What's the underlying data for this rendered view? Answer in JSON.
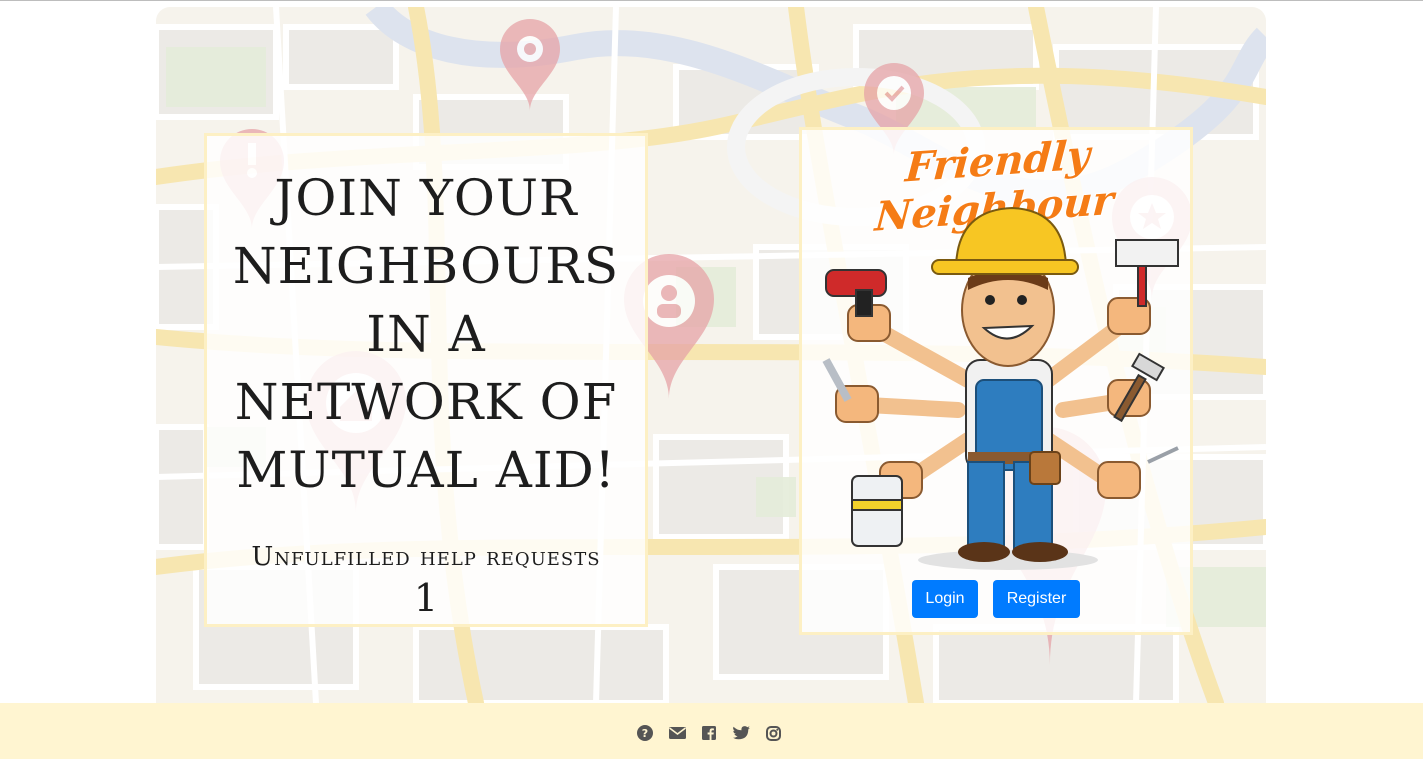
{
  "hero": {
    "heading": "Join your neighbours in a network of mutual aid!",
    "requests_label": "Unfulfilled help requests",
    "requests_count": "1"
  },
  "brand": {
    "name": "Friendly Neighbour",
    "color": "#f57c16"
  },
  "auth": {
    "login_label": "Login",
    "register_label": "Register",
    "button_color": "#007bff"
  },
  "footer": {
    "background": "#fff5d1",
    "icons": [
      "question-circle-icon",
      "envelope-icon",
      "facebook-icon",
      "twitter-icon",
      "instagram-icon"
    ]
  },
  "map_pins": [
    "location-pin-icon",
    "check-pin-icon",
    "alert-pin-icon",
    "user-pin-icon",
    "home-pin-icon",
    "star-pin-icon"
  ]
}
